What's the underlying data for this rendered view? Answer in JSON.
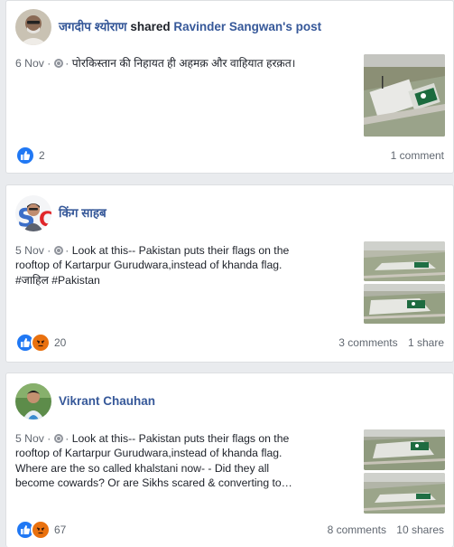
{
  "posts": [
    {
      "author": "जगदीप श्योराण",
      "action": "shared",
      "shared_from": "Ravinder Sangwan's post",
      "date": "6 Nov",
      "lines": [
        "पोरकिस्तान की निहायत ही अहमक़ और वाहियात हरक़त।"
      ],
      "reaction_count": "2",
      "comments": "1 comment",
      "shares": ""
    },
    {
      "author": "किंग साहब",
      "date": "5 Nov",
      "lines": [
        "Look at this-- Pakistan puts their flags on the",
        "rooftop of Kartarpur Gurudwara,instead of khanda flag.",
        "#जाहिल #Pakistan"
      ],
      "reaction_count": "20",
      "comments": "3 comments",
      "shares": "1 share"
    },
    {
      "author": "Vikrant Chauhan",
      "date": "5 Nov",
      "lines": [
        "Look at this-- Pakistan puts their flags on the",
        "rooftop of Kartarpur Gurudwara,instead of khanda flag.",
        "Where are the so called khalstani now- - Did they all",
        "become cowards? Or are Sikhs scared & converting to…"
      ],
      "reaction_count": "67",
      "comments": "8 comments",
      "shares": "10 shares"
    }
  ],
  "icons": {
    "like": "thumbs-up-icon",
    "angry": "angry-face-icon",
    "privacy": "globe-icon"
  },
  "colors": {
    "link": "#365899",
    "like": "#2078f4",
    "angry": "#e9710f",
    "meta": "#616770"
  }
}
